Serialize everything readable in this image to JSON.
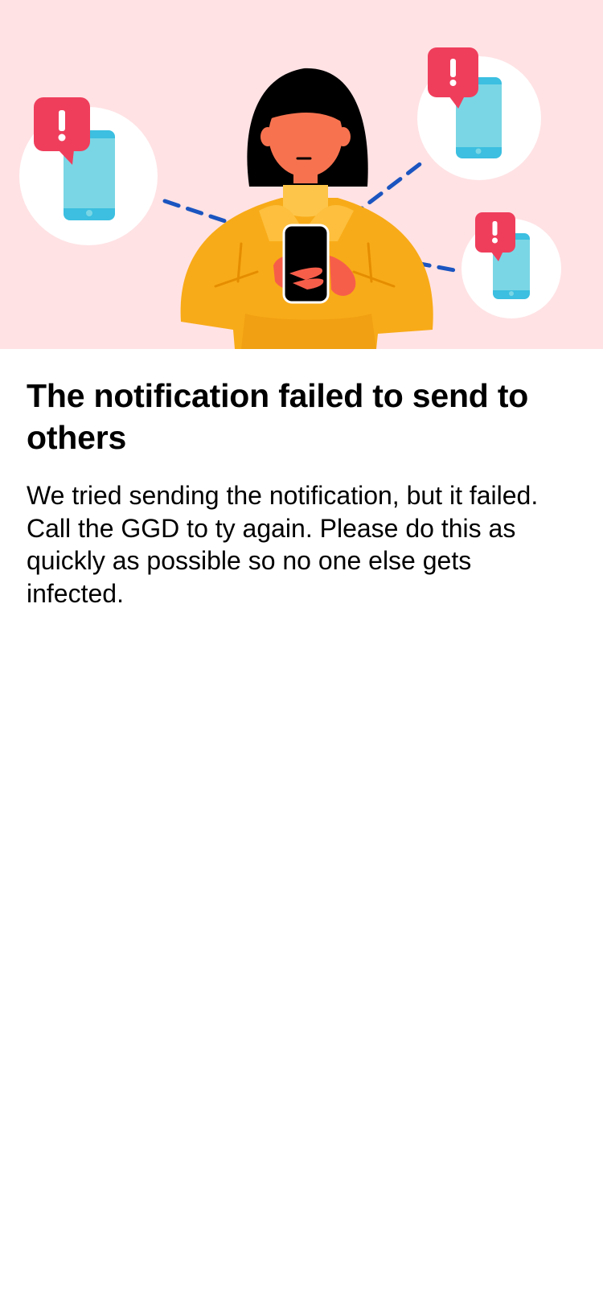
{
  "illustration": {
    "subject": "person-holding-phone-with-failed-notifications-icon",
    "colors": {
      "background": "#ffe2e4",
      "alert": "#ef3e5c",
      "phone": "#7ad6e5",
      "dash": "#1b55c0",
      "sweater": "#f8ab18"
    }
  },
  "content": {
    "title": "The notification failed to send to others",
    "body": "We tried sending the notification, but it failed. Call the GGD to ty again. Please do this as quickly as possible so no one else gets infected."
  }
}
